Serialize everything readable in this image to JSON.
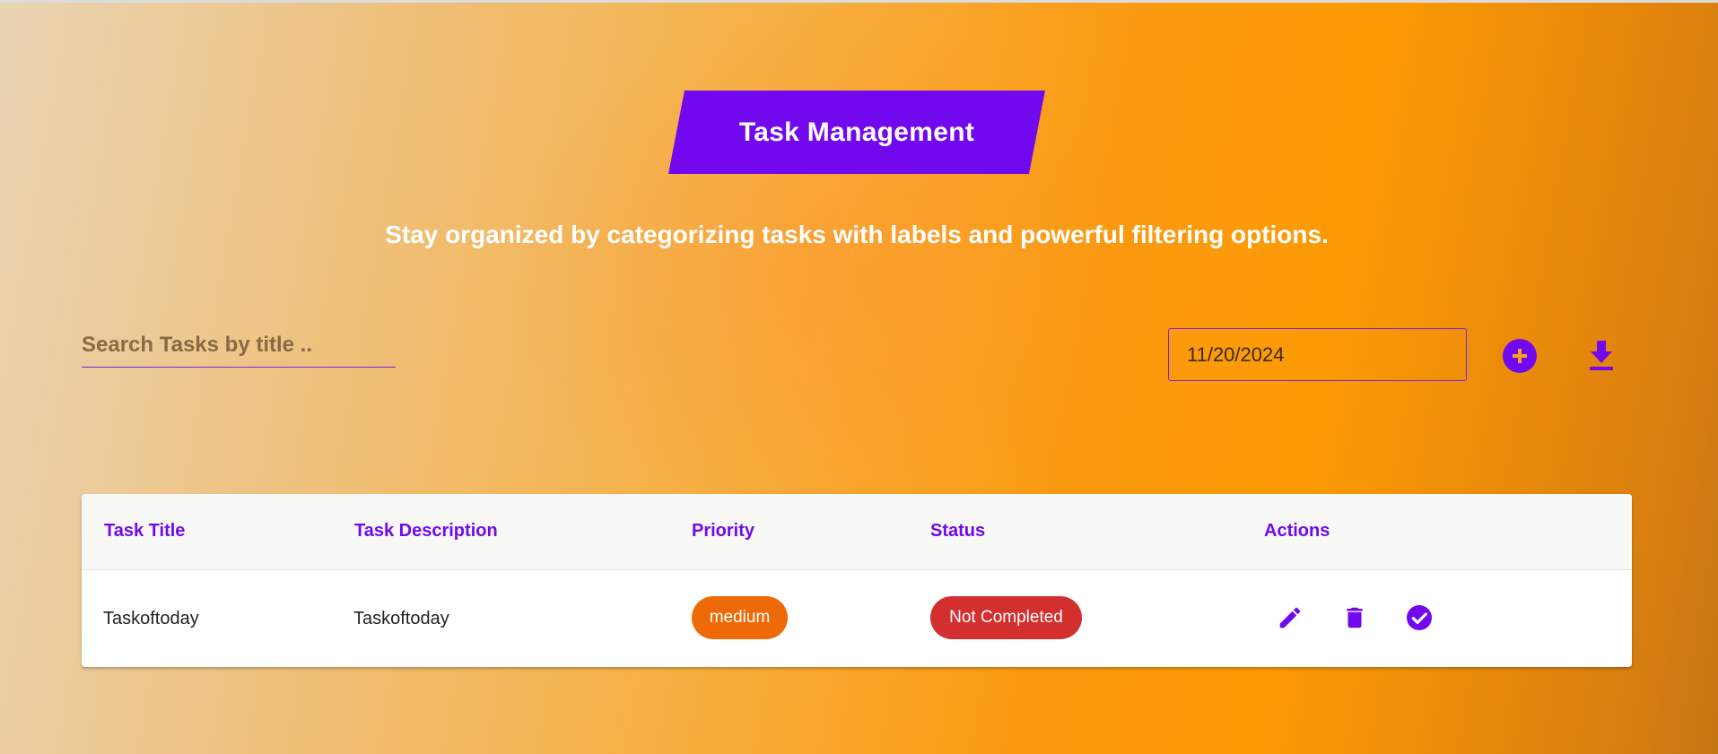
{
  "header": {
    "title": "Task Management",
    "subtitle": "Stay organized by categorizing tasks with labels and powerful filtering options."
  },
  "toolbar": {
    "search_placeholder": "Search Tasks by title ..",
    "search_value": "",
    "date_value": "11/20/2024",
    "add_icon": "add-circle-icon",
    "download_icon": "download-icon"
  },
  "table": {
    "columns": [
      "Task Title",
      "Task Description",
      "Priority",
      "Status",
      "Actions"
    ],
    "rows": [
      {
        "title": "Taskoftoday",
        "description": "Taskoftoday",
        "priority": "medium",
        "status": "Not Completed",
        "actions": [
          "edit-icon",
          "delete-icon",
          "check-circle-icon"
        ]
      }
    ]
  },
  "colors": {
    "accent": "#7108ee",
    "priority_medium": "#ee6a09",
    "status_not_completed": "#d32f2f"
  }
}
